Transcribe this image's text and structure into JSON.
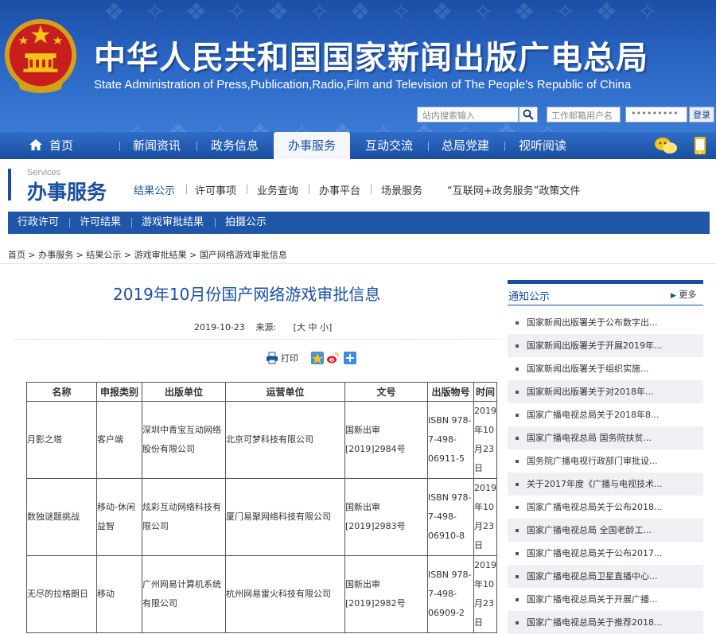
{
  "header": {
    "title_cn": "中华人民共和国国家新闻出版广电总局",
    "title_en": "State Administration of Press,Publication,Radio,Film and Television of The People's Republic of China",
    "search_placeholder": "站内搜索输入",
    "mail_user_placeholder": "工作邮箱用户名",
    "mail_password_mask": "•••••••••",
    "login_label": "登录"
  },
  "main_nav": [
    {
      "label": "首页"
    },
    {
      "label": "新闻资讯"
    },
    {
      "label": "政务信息"
    },
    {
      "label": "办事服务"
    },
    {
      "label": "互动交流"
    },
    {
      "label": "总局党建"
    },
    {
      "label": "视听阅读"
    }
  ],
  "services": {
    "en_label": "Services",
    "cn_label": "办事服务",
    "links": [
      {
        "label": "结果公示"
      },
      {
        "label": "许可事项"
      },
      {
        "label": "业务查询"
      },
      {
        "label": "办事平台"
      },
      {
        "label": "场景服务"
      },
      {
        "label": "“互联网+政务服务”政策文件"
      }
    ]
  },
  "sub_nav": [
    {
      "label": "行政许可"
    },
    {
      "label": "许可结果"
    },
    {
      "label": "游戏审批结果"
    },
    {
      "label": "拍摄公示"
    }
  ],
  "breadcrumb": "首页 > 办事服务 > 结果公示 > 游戏审批结果 > 国产网络游戏审批信息",
  "article": {
    "title": "2019年10月份国产网络游戏审批信息",
    "date": "2019-10-23",
    "source_label": "来源:",
    "font_size_label": "[大 中 小]",
    "print_label": "打印"
  },
  "table": {
    "headers": [
      "名称",
      "申报类别",
      "出版单位",
      "运营单位",
      "文号",
      "出版物号",
      "时间"
    ],
    "rows": [
      {
        "name": "月影之塔",
        "category": "客户端",
        "publisher": "深圳中青宝互动网络股份有限公司",
        "operator": "北京可梦科技有限公司",
        "doc": "国新出审[2019]2984号",
        "isbn": "ISBN 978-7-498-06911-5",
        "date": "2019年10月23日"
      },
      {
        "name": "数独谜题挑战",
        "category": "移动-休闲益智",
        "publisher": "炫彩互动网络科技有限公司",
        "operator": "厦门易聚网络科技有限公司",
        "doc": "国新出审[2019]2983号",
        "isbn": "ISBN 978-7-498-06910-8",
        "date": "2019年10月23日"
      },
      {
        "name": "无尽的拉格朗日",
        "category": "移动",
        "publisher": "广州网易计算机系统有限公司",
        "operator": "杭州网易雷火科技有限公司",
        "doc": "国新出审[2019]2982号",
        "isbn": "ISBN 978-7-498-06909-2",
        "date": "2019年10月23日"
      }
    ]
  },
  "sidebar": {
    "title": "通知公示",
    "more_label": "更多",
    "items": [
      {
        "text": "国家新闻出版署关于公布数字出..."
      },
      {
        "text": "国家新闻出版署关于开展2019年..."
      },
      {
        "text": "国家新闻出版署关于组织实施..."
      },
      {
        "text": "国家新闻出版署关于对2018年..."
      },
      {
        "text": "国家广播电视总局关于2018年8..."
      },
      {
        "text": "国家广播电视总局 国务院扶贫..."
      },
      {
        "text": "国务院广播电视行政部门审批设..."
      },
      {
        "text": "关于2017年度《广播与电视技术..."
      },
      {
        "text": "国家广播电视总局关于公布2018..."
      },
      {
        "text": "国家广播电视总局 全国老龄工..."
      },
      {
        "text": "国家广播电视总局关于公布2017..."
      },
      {
        "text": "国家广播电视总局卫星直播中心..."
      },
      {
        "text": "国家广播电视总局关于开展广播..."
      },
      {
        "text": "国家广播电视总局关于推荐2018..."
      }
    ]
  },
  "colors": {
    "brand_blue": "#1a4fa0",
    "banner_blue": "#2a66c4",
    "sidebar_shade": "#eef0f3"
  }
}
